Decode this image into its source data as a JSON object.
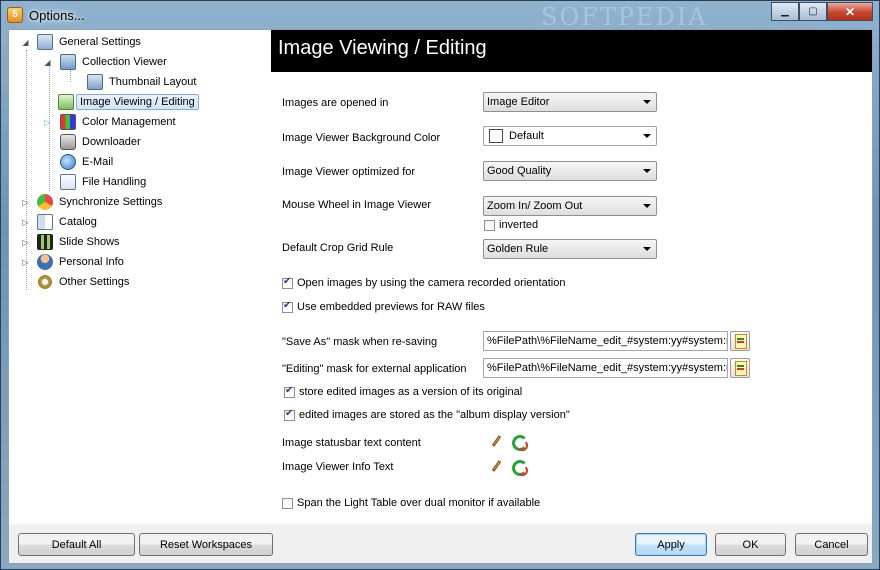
{
  "window": {
    "title": "Options..."
  },
  "tree": {
    "items": [
      {
        "label": "General Settings"
      },
      {
        "label": "Collection Viewer"
      },
      {
        "label": "Thumbnail Layout"
      },
      {
        "label": "Image Viewing / Editing"
      },
      {
        "label": "Color Management"
      },
      {
        "label": "Downloader"
      },
      {
        "label": "E-Mail"
      },
      {
        "label": "File Handling"
      },
      {
        "label": "Synchronize Settings"
      },
      {
        "label": "Catalog"
      },
      {
        "label": "Slide Shows"
      },
      {
        "label": "Personal Info"
      },
      {
        "label": "Other Settings"
      }
    ]
  },
  "panel": {
    "header": "Image Viewing / Editing",
    "opened_in": {
      "label": "Images are opened in",
      "value": "Image Editor"
    },
    "bg_color": {
      "label": "Image Viewer Background Color",
      "value": "Default"
    },
    "optimized": {
      "label": "Image Viewer optimized for",
      "value": "Good Quality"
    },
    "mouse_wheel": {
      "label": "Mouse Wheel in Image Viewer",
      "value": "Zoom In/ Zoom Out",
      "inverted_label": "inverted"
    },
    "crop_grid": {
      "label": "Default Crop Grid Rule",
      "value": "Golden Rule"
    },
    "open_recorded": "Open images by using the camera recorded orientation",
    "embedded_previews": "Use embedded previews for RAW files",
    "save_as_mask": {
      "label": "\"Save As\" mask when re-saving",
      "value": "%FilePath\\%FileName_edit_#system:yy#system:m"
    },
    "editing_mask": {
      "label": "\"Editing\" mask for external application",
      "value": "%FilePath\\%FileName_edit_#system:yy#system:m"
    },
    "store_version": "store edited images as a version of its original",
    "album_display": "edited images are stored as the \"album display version\"",
    "statusbar_text": "Image statusbar text content",
    "info_text": "Image Viewer Info Text",
    "span_light_table": "Span the Light Table over dual monitor if available"
  },
  "footer": {
    "default_all": "Default All",
    "reset_workspaces": "Reset Workspaces",
    "apply": "Apply",
    "ok": "OK",
    "cancel": "Cancel"
  }
}
